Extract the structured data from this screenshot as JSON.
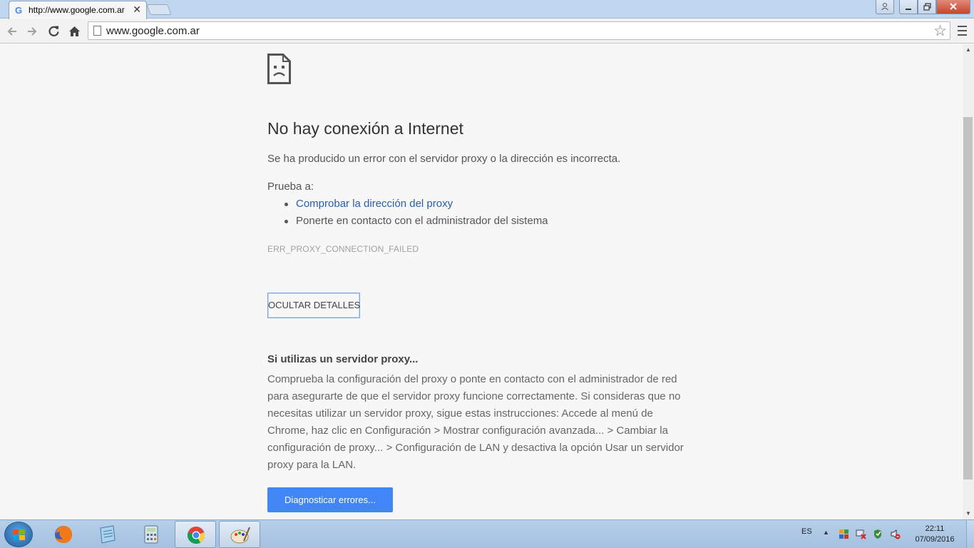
{
  "browser": {
    "tab_title": "http://www.google.com.ar",
    "tab_favicon": "G",
    "tab_close": "✕",
    "url": "www.google.com.ar"
  },
  "error_page": {
    "heading": "No hay conexión a Internet",
    "description": "Se ha producido un error con el servidor proxy o la dirección es incorrecta.",
    "try_label": "Prueba a:",
    "suggestions": [
      {
        "text": "Comprobar la dirección del proxy",
        "is_link": true
      },
      {
        "text": "Ponerte en contacto con el administrador del sistema",
        "is_link": false
      }
    ],
    "error_code": "ERR_PROXY_CONNECTION_FAILED",
    "details_button": "OCULTAR DETALLES",
    "details_title": "Si utilizas un servidor proxy...",
    "details_body": "Comprueba la configuración del proxy o ponte en contacto con el administrador de red para asegurarte de que el servidor proxy funcione correctamente. Si consideras que no necesitas utilizar un servidor proxy, sigue estas instrucciones: Accede al menú de Chrome, haz clic en Configuración > Mostrar configuración avanzada... > Cambiar la configuración de proxy... > Configuración de LAN y desactiva la opción Usar un servidor proxy para la LAN.",
    "diagnose_button": "Diagnosticar errores..."
  },
  "taskbar": {
    "apps": [
      "firefox-icon",
      "notepad-icon",
      "calculator-icon",
      "chrome-icon",
      "paint-icon"
    ],
    "active_app": "chrome-icon",
    "language": "ES",
    "time": "22:11",
    "date": "07/09/2016"
  },
  "colors": {
    "link": "#2a5db0",
    "primary_button": "#4285f4",
    "page_background": "#f7f7f7",
    "title_bar": "#bfd6ee"
  }
}
